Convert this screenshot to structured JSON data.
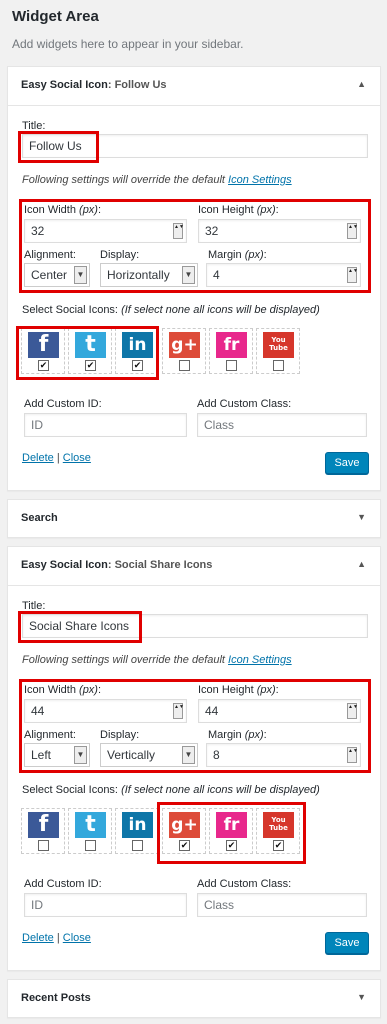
{
  "sidebar_area": {
    "title": "Widget Area",
    "description": "Add widgets here to appear in your sidebar."
  },
  "common": {
    "title_label": "Title:",
    "note_prefix": "Following settings will override the default ",
    "note_link": "Icon Settings",
    "icon_width_label": "Icon Width ",
    "icon_height_label": "Icon Height ",
    "px_unit": "(px)",
    "colon": ":",
    "alignment_label": "Alignment:",
    "display_label": "Display:",
    "margin_label": "Margin ",
    "select_icons_label": "Select Social Icons: ",
    "select_icons_note": "(If select none all icons will be displayed)",
    "custom_id_label": "Add Custom ID:",
    "custom_class_label": "Add Custom Class:",
    "custom_id_placeholder": "ID",
    "custom_class_placeholder": "Class",
    "delete_link": "Delete",
    "separator": "|",
    "close_link": "Close",
    "save_button": "Save"
  },
  "icons": [
    {
      "name": "facebook",
      "glyph": "f",
      "color": "#3b5998"
    },
    {
      "name": "twitter",
      "glyph": "t",
      "color": "#33a8dc"
    },
    {
      "name": "linkedin",
      "glyph": "in",
      "color": "#0e76a8"
    },
    {
      "name": "google-plus",
      "glyph": "g+",
      "color": "#dd4b39"
    },
    {
      "name": "friendfeed",
      "glyph": "fr",
      "color": "#e8288c"
    },
    {
      "name": "youtube",
      "glyph": "You Tube",
      "color": "#d6362b"
    }
  ],
  "widget1": {
    "prefix": "Easy Social Icon",
    "sep": ": ",
    "name": "Follow Us",
    "arrow": "▲",
    "title_value": "Follow Us",
    "icon_width": "32",
    "icon_height": "32",
    "alignment": "Center",
    "display": "Horizontally",
    "margin": "4",
    "checked": [
      true,
      true,
      true,
      false,
      false,
      false
    ]
  },
  "widget_search": {
    "title": "Search",
    "arrow": "▼"
  },
  "widget2": {
    "prefix": "Easy Social Icon",
    "sep": ": ",
    "name": "Social Share Icons",
    "arrow": "▲",
    "title_value": "Social Share Icons",
    "icon_width": "44",
    "icon_height": "44",
    "alignment": "Left",
    "display": "Vertically",
    "margin": "8",
    "checked": [
      false,
      false,
      false,
      true,
      true,
      true
    ]
  },
  "widget_recent": {
    "title": "Recent Posts",
    "arrow": "▼"
  },
  "glyphs": {
    "spin": "▲▼",
    "dropdown": "▼",
    "check": "✔"
  }
}
